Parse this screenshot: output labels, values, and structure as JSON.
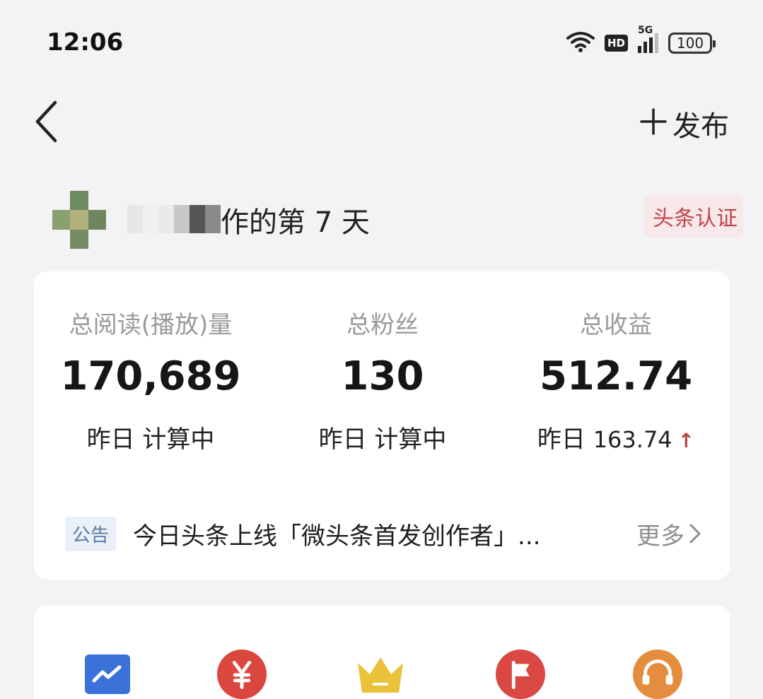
{
  "status_bar": {
    "time": "12:06",
    "network": "5G",
    "hd": "HD",
    "battery": "100",
    "icons": [
      "wifi-icon",
      "hd-icon",
      "signal-icon",
      "battery-icon"
    ]
  },
  "nav": {
    "back_icon": "chevron-left-icon",
    "publish_label": "发布",
    "publish_icon": "plus-icon"
  },
  "profile": {
    "days_text": "作的第 7 天",
    "certification": "头条认证"
  },
  "stats": [
    {
      "label": "总阅读(播放)量",
      "value": "170,689",
      "sub_prefix": "昨日",
      "sub_value": "计算中",
      "trend": ""
    },
    {
      "label": "总粉丝",
      "value": "130",
      "sub_prefix": "昨日",
      "sub_value": "计算中",
      "trend": ""
    },
    {
      "label": "总收益",
      "value": "512.74",
      "sub_prefix": "昨日",
      "sub_value": "163.74",
      "trend": "↑"
    }
  ],
  "notice": {
    "tag": "公告",
    "text": "今日头条上线「微头条首发创作者」...",
    "more": "更多"
  },
  "tools": {
    "icons": [
      "trend-chart-icon",
      "yuan-icon",
      "crown-icon",
      "flag-icon",
      "headset-icon"
    ],
    "colors": {
      "chart": "#3b72d9",
      "yuan": "#d9473f",
      "crown": "#e9c23a",
      "flag": "#d94843",
      "headset": "#e58d3f"
    }
  },
  "colors": {
    "accent_red": "#c0454a",
    "background": "#f3f3f5",
    "card": "#ffffff"
  }
}
